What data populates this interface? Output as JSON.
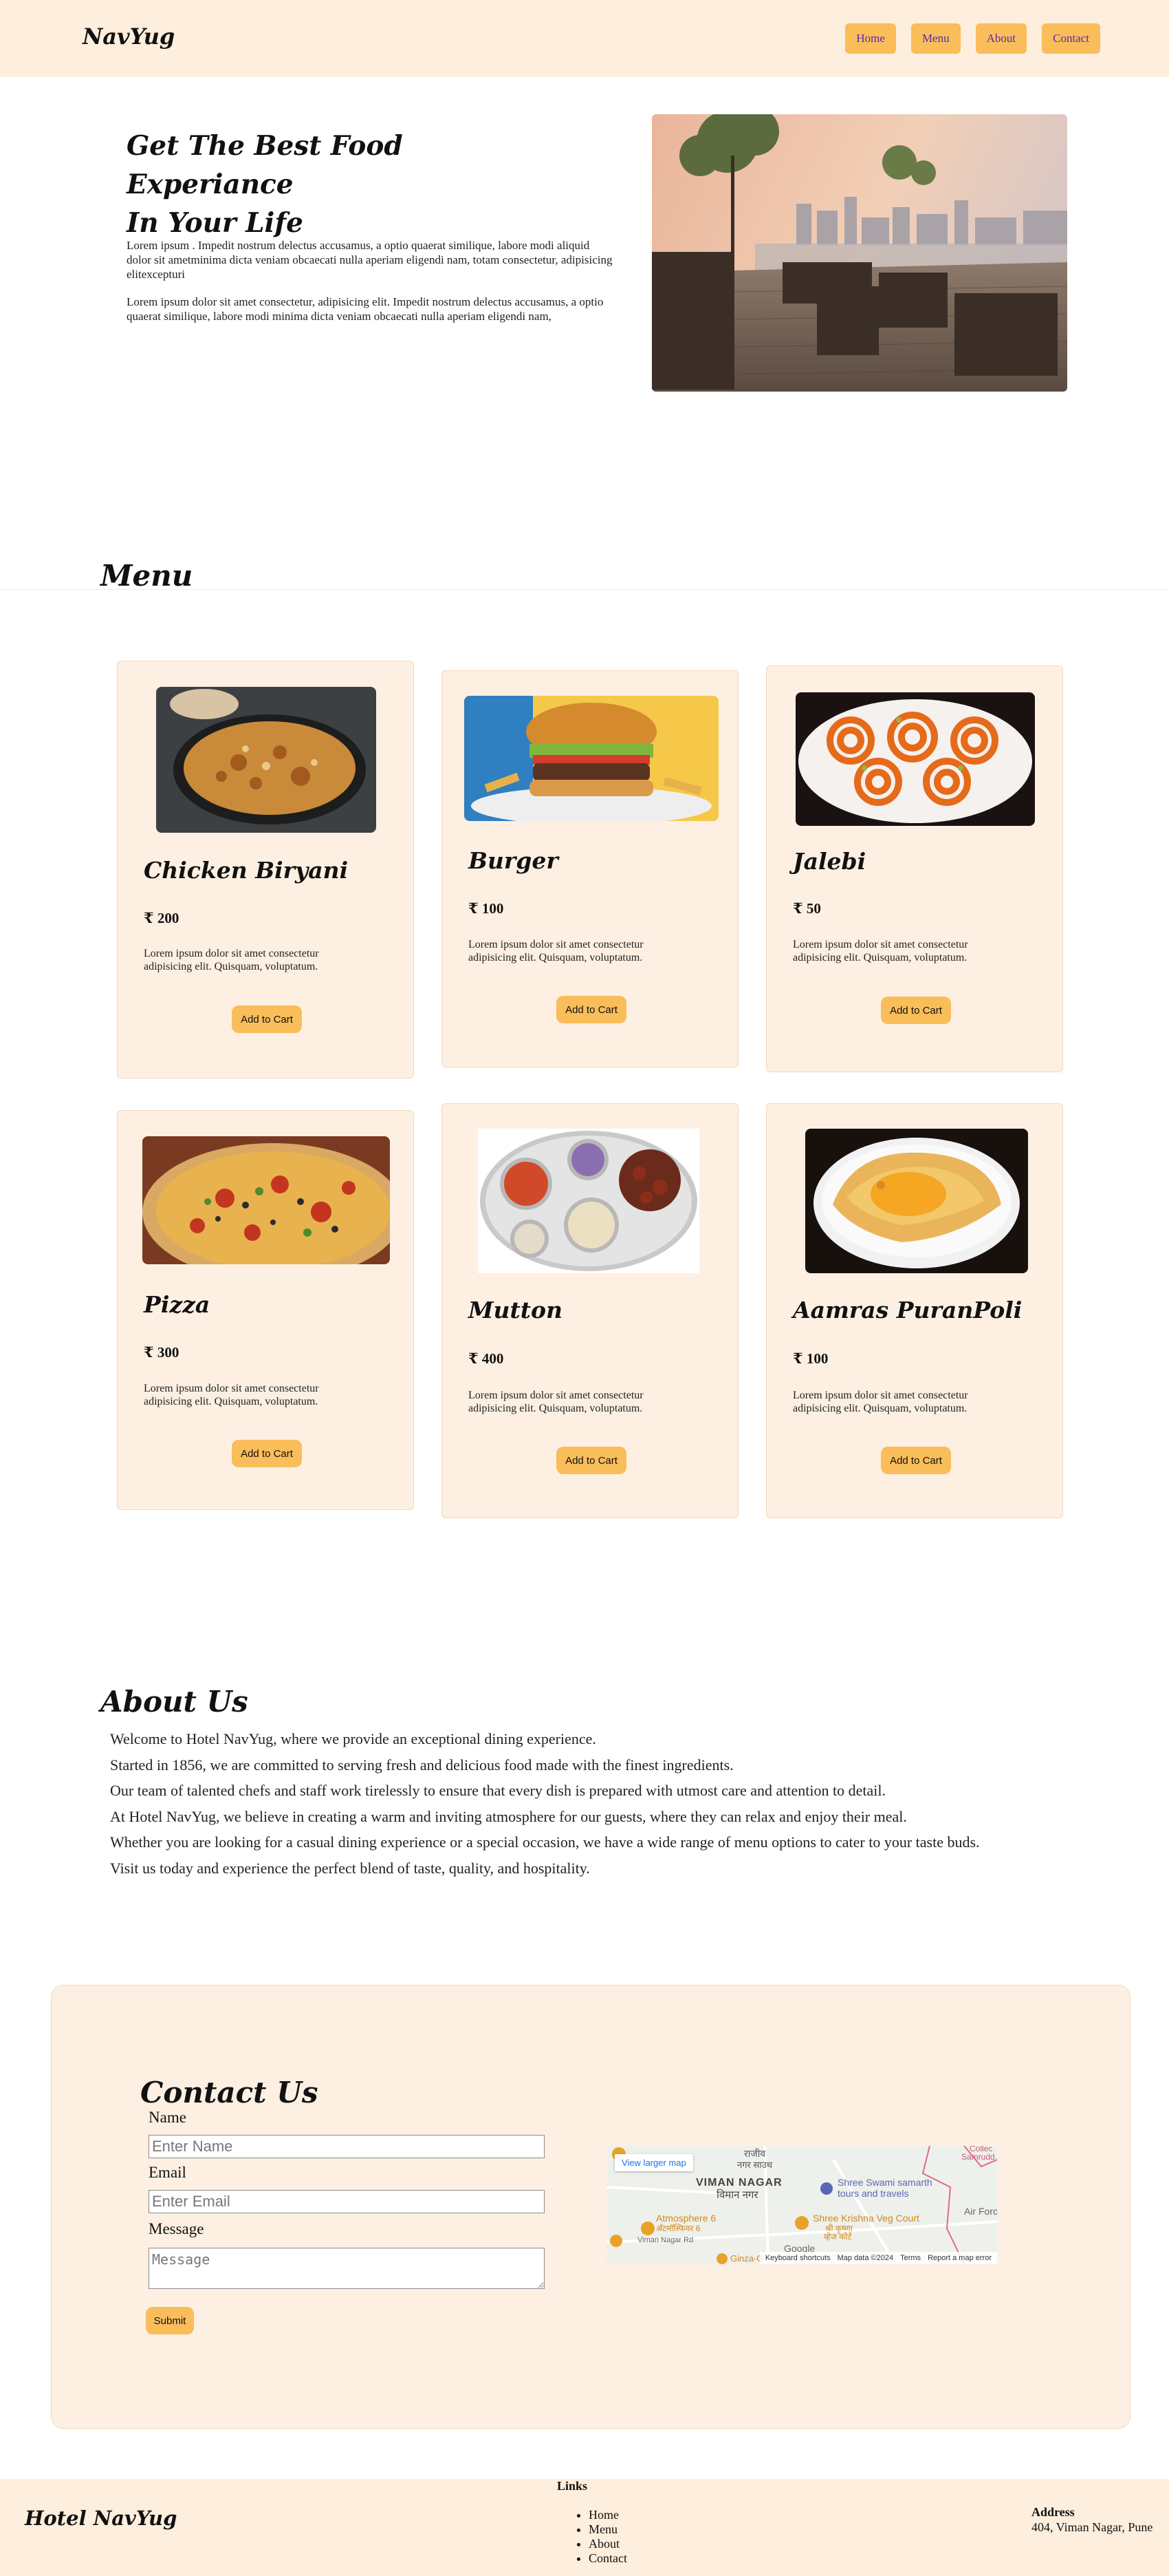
{
  "header": {
    "logo": "NavYug",
    "nav": [
      "Home",
      "Menu",
      "About",
      "Contact"
    ]
  },
  "hero": {
    "title_line1": "Get The Best Food Experiance",
    "title_line2": "In Your Life",
    "paragraph1": "Lorem ipsum . Impedit nostrum delectus accusamus, a optio quaerat similique, labore modi aliquid dolor sit ametminima dicta veniam obcaecati nulla aperiam eligendi nam, totam consectetur, adipisicing elitexcepturi",
    "paragraph2": "Lorem ipsum dolor sit amet consectetur, adipisicing elit. Impedit nostrum delectus accusamus, a optio quaerat similique, labore modi minima dicta veniam obcaecati nulla aperiam eligendi nam,",
    "image": "restaurant-terrace-photo"
  },
  "menu": {
    "title": "Menu",
    "button_label": "Add to Cart",
    "items": [
      {
        "name": "Chicken Biryani",
        "price": "₹ 200",
        "desc": "Lorem ipsum dolor sit amet consectetur adipisicing elit. Quisquam, voluptatum.",
        "image": "biryani-photo"
      },
      {
        "name": "Burger",
        "price": "₹ 100",
        "desc": "Lorem ipsum dolor sit amet consectetur adipisicing elit. Quisquam, voluptatum.",
        "image": "burger-photo"
      },
      {
        "name": "Jalebi",
        "price": "₹ 50",
        "desc": "Lorem ipsum dolor sit amet consectetur adipisicing elit. Quisquam, voluptatum.",
        "image": "jalebi-photo"
      },
      {
        "name": "Pizza",
        "price": "₹ 300",
        "desc": "Lorem ipsum dolor sit amet consectetur adipisicing elit. Quisquam, voluptatum.",
        "image": "pizza-photo"
      },
      {
        "name": "Mutton",
        "price": "₹ 400",
        "desc": "Lorem ipsum dolor sit amet consectetur adipisicing elit. Quisquam, voluptatum.",
        "image": "mutton-thali-photo"
      },
      {
        "name": "Aamras PuranPoli",
        "price": "₹ 100",
        "desc": "Lorem ipsum dolor sit amet consectetur adipisicing elit. Quisquam, voluptatum.",
        "image": "puranpoli-photo"
      }
    ]
  },
  "about": {
    "title": "About Us",
    "lines": [
      "Welcome to Hotel NavYug, where we provide an exceptional dining experience.",
      "Started in 1856, we are committed to serving fresh and delicious food made with the finest ingredients.",
      "Our team of talented chefs and staff work tirelessly to ensure that every dish is prepared with utmost care and attention to detail.",
      "At Hotel NavYug, we believe in creating a warm and inviting atmosphere for our guests, where they can relax and enjoy their meal.",
      "Whether you are looking for a casual dining experience or a special occasion, we have a wide range of menu options to cater to your taste buds.",
      "Visit us today and experience the perfect blend of taste, quality, and hospitality."
    ]
  },
  "contact": {
    "title": "Contact Us",
    "name_label": "Name",
    "name_placeholder": "Enter Name",
    "email_label": "Email",
    "email_placeholder": "Enter Email",
    "message_label": "Message",
    "message_placeholder": "Message",
    "submit_label": "Submit",
    "map": {
      "view_larger": "View larger map",
      "area_en": "VIMAN NAGAR",
      "area_mr": "विमान नगर",
      "place_top_mr_1": "राजीव",
      "place_top_mr_2": "नगर साउथ",
      "poi1": "Shree Swami samarth",
      "poi1_line2": "tours and travels",
      "poi2": "Shree Krishna Veg Court",
      "poi2_mr_1": "श्री कृष्णा",
      "poi2_mr_2": "व्हेज कोर्ट",
      "poi3": "Atmosphere 6",
      "poi3_mr": "अ‍ॅटमॉस्फियर 6",
      "poi4": "Ginza-G",
      "road": "Viman Nagar Rd",
      "edge_top": "Collec",
      "edge_top2": "Samrudd",
      "air_force": "Air Forc",
      "google": "Google",
      "footer": [
        "Keyboard shortcuts",
        "Map data ©2024",
        "Terms",
        "Report a map error"
      ]
    }
  },
  "footer": {
    "logo": "Hotel NavYug",
    "links_title": "Links",
    "links": [
      "Home",
      "Menu",
      "About",
      "Contact"
    ],
    "address_title": "Address",
    "address": "404, Viman Nagar, Pune"
  },
  "colors": {
    "header_bg": "#fdeedd",
    "card_bg": "#fdf0e2",
    "button": "#f9bd5a",
    "nav_text": "#5a2bb0"
  }
}
